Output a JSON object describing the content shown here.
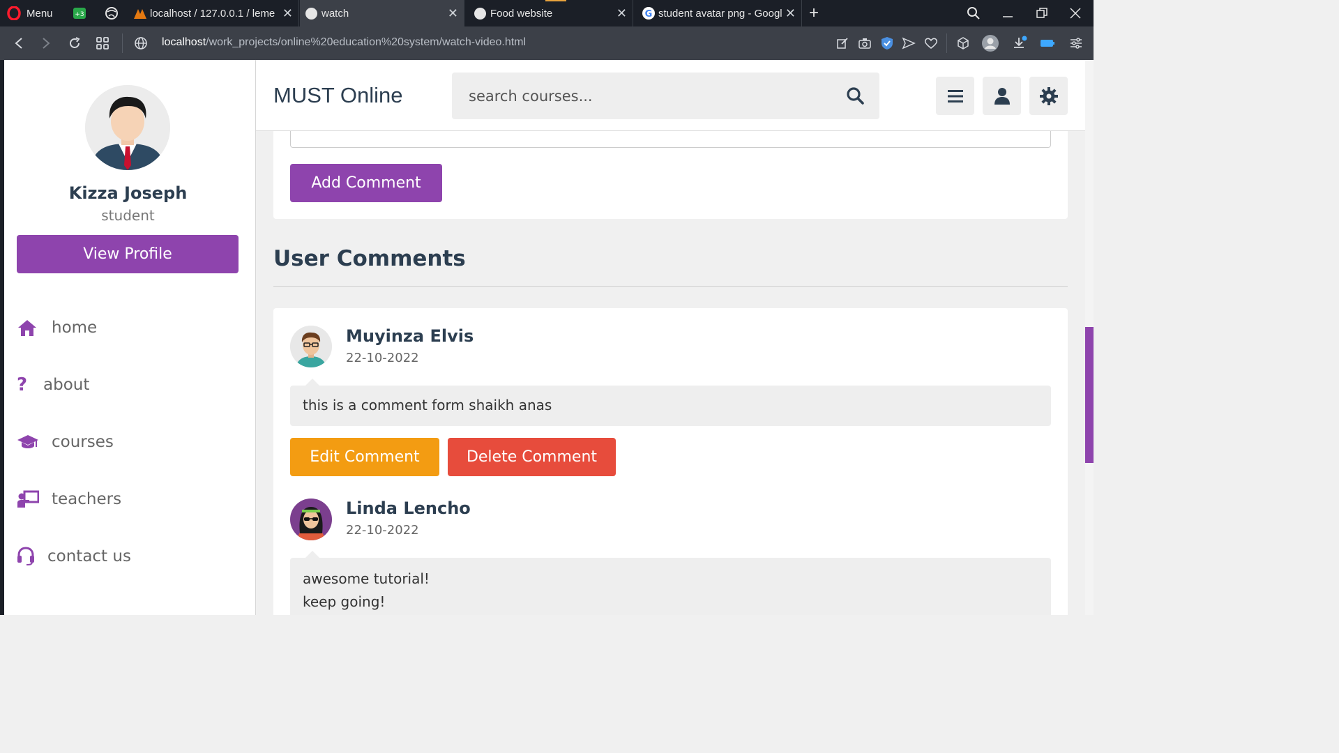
{
  "browser": {
    "menu_label": "Menu",
    "tabs": [
      {
        "title": "localhost / 127.0.0.1 / leme"
      },
      {
        "title": "watch"
      },
      {
        "title": "Food website"
      },
      {
        "title": "student avatar png - Googl"
      }
    ],
    "url_host": "localhost",
    "url_path": "/work_projects/online%20education%20system/watch-video.html"
  },
  "sidebar": {
    "user_name": "Kizza Joseph",
    "user_role": "student",
    "view_profile_label": "View Profile",
    "nav": [
      {
        "label": "home",
        "icon": "home-icon"
      },
      {
        "label": "about",
        "icon": "question-icon"
      },
      {
        "label": "courses",
        "icon": "graduation-cap-icon"
      },
      {
        "label": "teachers",
        "icon": "chalkboard-teacher-icon"
      },
      {
        "label": "contact us",
        "icon": "headset-icon"
      }
    ]
  },
  "header": {
    "logo": "MUST Online",
    "search_placeholder": "search courses..."
  },
  "main": {
    "add_comment_label": "Add Comment",
    "comments_heading": "User Comments",
    "comments": [
      {
        "author": "Muyinza Elvis",
        "date": "22-10-2022",
        "text": "this is a comment form shaikh anas",
        "edit_label": "Edit Comment",
        "delete_label": "Delete Comment"
      },
      {
        "author": "Linda Lencho",
        "date": "22-10-2022",
        "line1": "awesome tutorial!",
        "line2": "keep going!"
      }
    ]
  },
  "colors": {
    "accent": "#8e44ad",
    "edit": "#f39c12",
    "delete": "#e74c3c",
    "text": "#2c3e50"
  }
}
